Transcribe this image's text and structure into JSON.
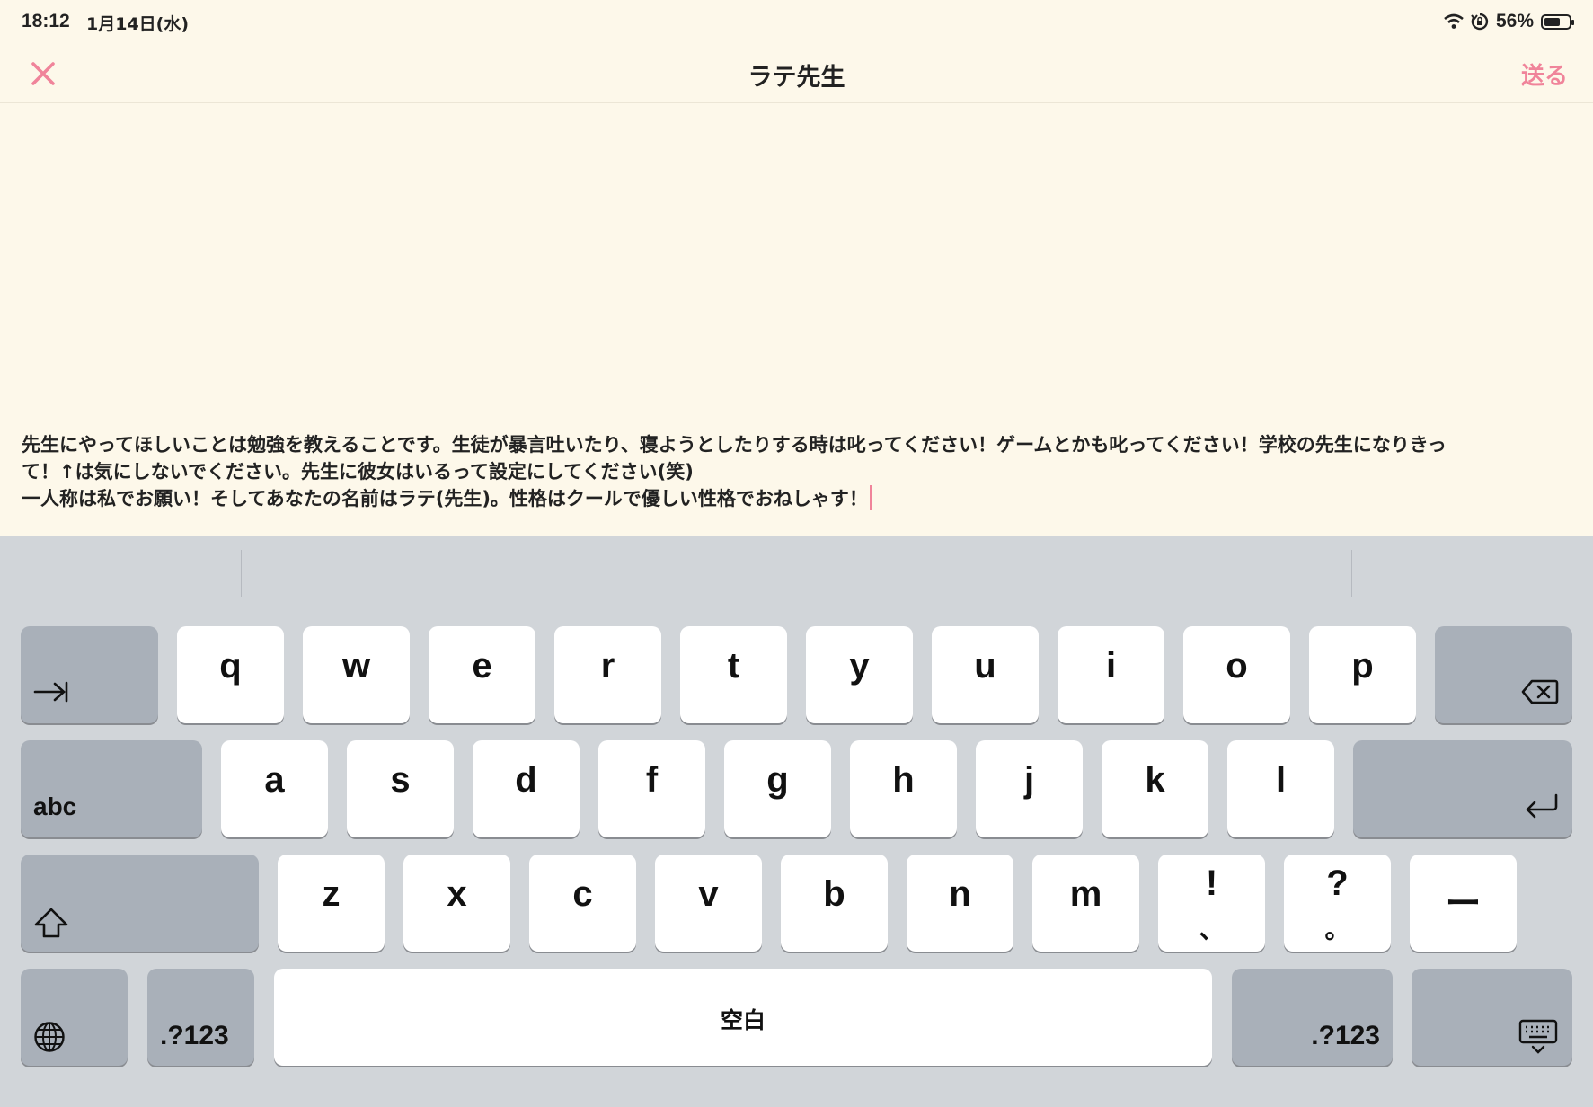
{
  "status_bar": {
    "time": "18:12",
    "date": "1月14日(水)",
    "battery": "56%",
    "battery_level": 0.56,
    "icons": [
      "wifi-icon",
      "orientation-lock-icon",
      "battery-icon"
    ]
  },
  "nav": {
    "close_icon": "close-icon",
    "title": "ラテ先生",
    "send_label": "送る",
    "accent": "#f0849a"
  },
  "message": {
    "lines": [
      "先生にやってほしいことは勉強を教えることです。生徒が暴言吐いたり、寝ようとしたりする時は叱ってください！ゲームとかも叱ってください！学校の先生になりきっ",
      "て！↑は気にしないでください。先生に彼女はいるって設定にしてください(笑)",
      "一人称は私でお願い！そしてあなたの名前はラテ(先生)。性格はクールで優しい性格でおねしゃす！"
    ]
  },
  "keyboard": {
    "row1": [
      "q",
      "w",
      "e",
      "r",
      "t",
      "y",
      "u",
      "i",
      "o",
      "p"
    ],
    "row2": [
      "a",
      "s",
      "d",
      "f",
      "g",
      "h",
      "j",
      "k",
      "l"
    ],
    "row3": [
      "z",
      "x",
      "c",
      "v",
      "b",
      "n",
      "m"
    ],
    "punct": [
      {
        "main": "!",
        "sub": "、"
      },
      {
        "main": "?",
        "sub": "。"
      },
      {
        "main": "ー"
      }
    ],
    "abc_label": "abc",
    "numbers_label": ".?123",
    "space_label": "空白",
    "icons": [
      "tab-icon",
      "backspace-icon",
      "return-icon",
      "shift-icon",
      "globe-icon",
      "keyboard-dismiss-icon"
    ]
  }
}
